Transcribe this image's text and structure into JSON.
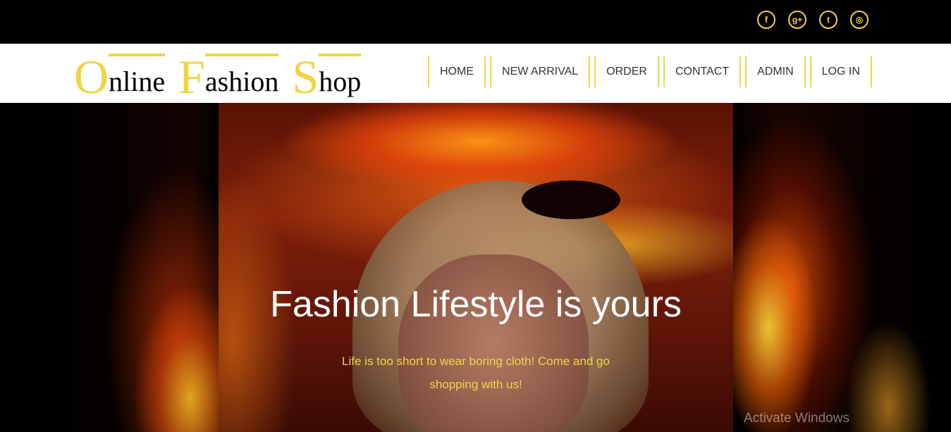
{
  "social": [
    {
      "icon": "facebook-icon",
      "glyph": "f"
    },
    {
      "icon": "google-plus-icon",
      "glyph": "g+"
    },
    {
      "icon": "twitter-icon",
      "glyph": "t"
    },
    {
      "icon": "dribbble-icon",
      "glyph": "◎"
    }
  ],
  "logo": {
    "word1_cap": "O",
    "word1_rest": "nline",
    "word2_cap": "F",
    "word2_rest": "ashion",
    "word3_cap": "S",
    "word3_rest": "hop"
  },
  "nav": {
    "home": "HOME",
    "new_arrival": "NEW ARRIVAL",
    "order": "ORDER",
    "contact": "CONTACT",
    "admin": "ADMIN",
    "login": "LOG IN"
  },
  "hero": {
    "headline": "Fashion Lifestyle is yours",
    "tagline": "Life is too short to wear boring cloth! Come and go shopping with us!"
  },
  "watermark": "Activate Windows",
  "colors": {
    "accent": "#f2d346",
    "topbar_bg": "#000000",
    "header_bg": "#ffffff",
    "nav_text": "#333333"
  }
}
